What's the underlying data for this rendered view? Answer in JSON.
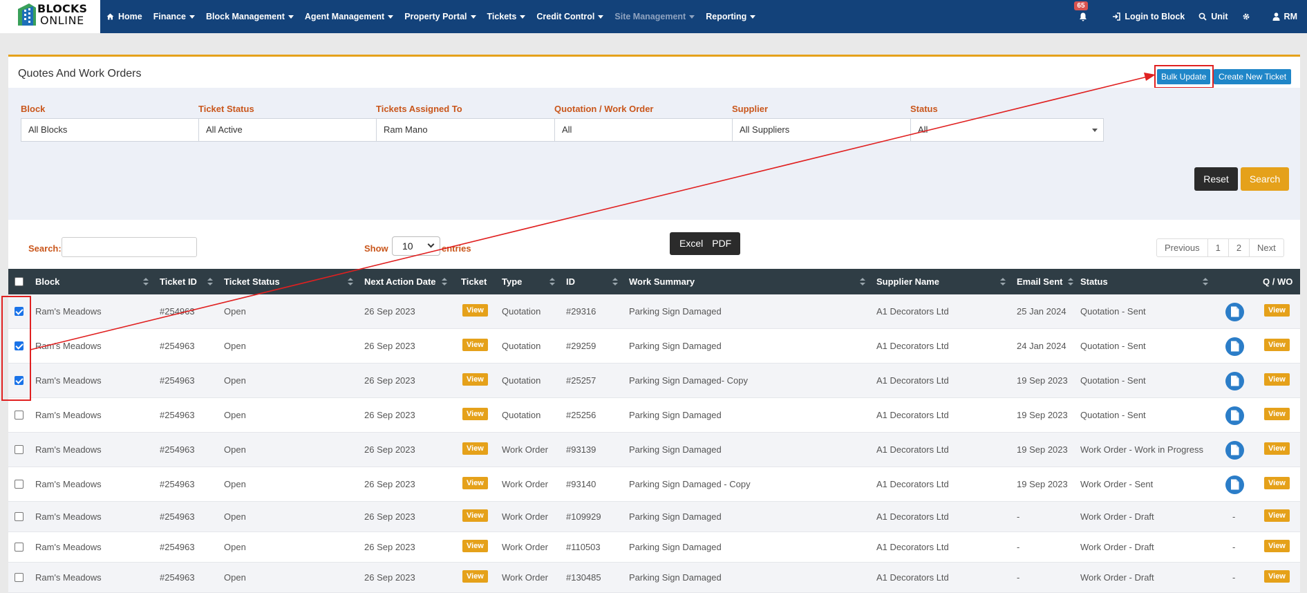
{
  "app": {
    "logo_line1": "BLOCKS",
    "logo_line2": "ONLINE"
  },
  "nav": {
    "items": [
      {
        "label": "Home",
        "caret": false,
        "dim": false
      },
      {
        "label": "Finance",
        "caret": true,
        "dim": false
      },
      {
        "label": "Block Management",
        "caret": true,
        "dim": false
      },
      {
        "label": "Agent Management",
        "caret": true,
        "dim": false
      },
      {
        "label": "Property Portal",
        "caret": true,
        "dim": false
      },
      {
        "label": "Tickets",
        "caret": true,
        "dim": false
      },
      {
        "label": "Credit Control",
        "caret": true,
        "dim": false
      },
      {
        "label": "Site Management",
        "caret": true,
        "dim": true
      },
      {
        "label": "Reporting",
        "caret": true,
        "dim": false
      }
    ],
    "notification_count": "65",
    "login_block": "Login to Block",
    "unit": "Unit",
    "user_initials": "RM"
  },
  "page": {
    "title": "Quotes And Work Orders",
    "bulk_update": "Bulk Update",
    "create_ticket": "Create New Ticket"
  },
  "filters": [
    {
      "label": "Block",
      "value": "All Blocks"
    },
    {
      "label": "Ticket Status",
      "value": "All Active"
    },
    {
      "label": "Tickets Assigned To",
      "value": "Ram Mano"
    },
    {
      "label": "Quotation / Work Order",
      "value": "All"
    },
    {
      "label": "Supplier",
      "value": "All Suppliers"
    },
    {
      "label": "Status",
      "value": "All"
    }
  ],
  "actions": {
    "reset": "Reset",
    "search": "Search"
  },
  "table_controls": {
    "search_label": "Search:",
    "show_label": "Show",
    "show_value": "10",
    "entries_label": "entries",
    "excel": "Excel",
    "pdf": "PDF",
    "pager": [
      "Previous",
      "1",
      "2",
      "Next"
    ]
  },
  "columns": [
    "Block",
    "Ticket ID",
    "Ticket Status",
    "Next Action Date",
    "Ticket",
    "Type",
    "ID",
    "Work Summary",
    "Supplier Name",
    "Email Sent",
    "Status",
    "Q / WO"
  ],
  "view_label": "View",
  "rows": [
    {
      "checked": true,
      "block": "Ram's Meadows",
      "ticket_id": "#254963",
      "ticket_status": "Open",
      "next_action": "26 Sep 2023",
      "type": "Quotation",
      "id": "#29316",
      "summary": "Parking Sign Damaged",
      "supplier": "A1 Decorators Ltd",
      "email_sent": "25 Jan 2024",
      "status": "Quotation - Sent",
      "doc": true
    },
    {
      "checked": true,
      "block": "Ram's Meadows",
      "ticket_id": "#254963",
      "ticket_status": "Open",
      "next_action": "26 Sep 2023",
      "type": "Quotation",
      "id": "#29259",
      "summary": "Parking Sign Damaged",
      "supplier": "A1 Decorators Ltd",
      "email_sent": "24 Jan 2024",
      "status": "Quotation - Sent",
      "doc": true
    },
    {
      "checked": true,
      "block": "Ram's Meadows",
      "ticket_id": "#254963",
      "ticket_status": "Open",
      "next_action": "26 Sep 2023",
      "type": "Quotation",
      "id": "#25257",
      "summary": "Parking Sign Damaged- Copy",
      "supplier": "A1 Decorators Ltd",
      "email_sent": "19 Sep 2023",
      "status": "Quotation - Sent",
      "doc": true
    },
    {
      "checked": false,
      "block": "Ram's Meadows",
      "ticket_id": "#254963",
      "ticket_status": "Open",
      "next_action": "26 Sep 2023",
      "type": "Quotation",
      "id": "#25256",
      "summary": "Parking Sign Damaged",
      "supplier": "A1 Decorators Ltd",
      "email_sent": "19 Sep 2023",
      "status": "Quotation - Sent",
      "doc": true
    },
    {
      "checked": false,
      "block": "Ram's Meadows",
      "ticket_id": "#254963",
      "ticket_status": "Open",
      "next_action": "26 Sep 2023",
      "type": "Work Order",
      "id": "#93139",
      "summary": "Parking Sign Damaged",
      "supplier": "A1 Decorators Ltd",
      "email_sent": "19 Sep 2023",
      "status": "Work Order - Work in Progress",
      "doc": true
    },
    {
      "checked": false,
      "block": "Ram's Meadows",
      "ticket_id": "#254963",
      "ticket_status": "Open",
      "next_action": "26 Sep 2023",
      "type": "Work Order",
      "id": "#93140",
      "summary": "Parking Sign Damaged - Copy",
      "supplier": "A1 Decorators Ltd",
      "email_sent": "19 Sep 2023",
      "status": "Work Order - Sent",
      "doc": true
    },
    {
      "checked": false,
      "block": "Ram's Meadows",
      "ticket_id": "#254963",
      "ticket_status": "Open",
      "next_action": "26 Sep 2023",
      "type": "Work Order",
      "id": "#109929",
      "summary": "Parking Sign Damaged",
      "supplier": "A1 Decorators Ltd",
      "email_sent": "-",
      "status": "Work Order - Draft",
      "doc": false,
      "doc_text": "-"
    },
    {
      "checked": false,
      "block": "Ram's Meadows",
      "ticket_id": "#254963",
      "ticket_status": "Open",
      "next_action": "26 Sep 2023",
      "type": "Work Order",
      "id": "#110503",
      "summary": "Parking Sign Damaged",
      "supplier": "A1 Decorators Ltd",
      "email_sent": "-",
      "status": "Work Order - Draft",
      "doc": false,
      "doc_text": "-"
    },
    {
      "checked": false,
      "block": "Ram's Meadows",
      "ticket_id": "#254963",
      "ticket_status": "Open",
      "next_action": "26 Sep 2023",
      "type": "Work Order",
      "id": "#130485",
      "summary": "Parking Sign Damaged",
      "supplier": "A1 Decorators Ltd",
      "email_sent": "-",
      "status": "Work Order - Draft",
      "doc": false,
      "doc_text": "-"
    }
  ],
  "colors": {
    "nav_bg": "#13427a",
    "accent_orange": "#e5a11a",
    "button_blue": "#1f86c8",
    "label_orange": "#c9561b",
    "header_dark": "#2f3d45",
    "annotation_red": "#e02020"
  }
}
